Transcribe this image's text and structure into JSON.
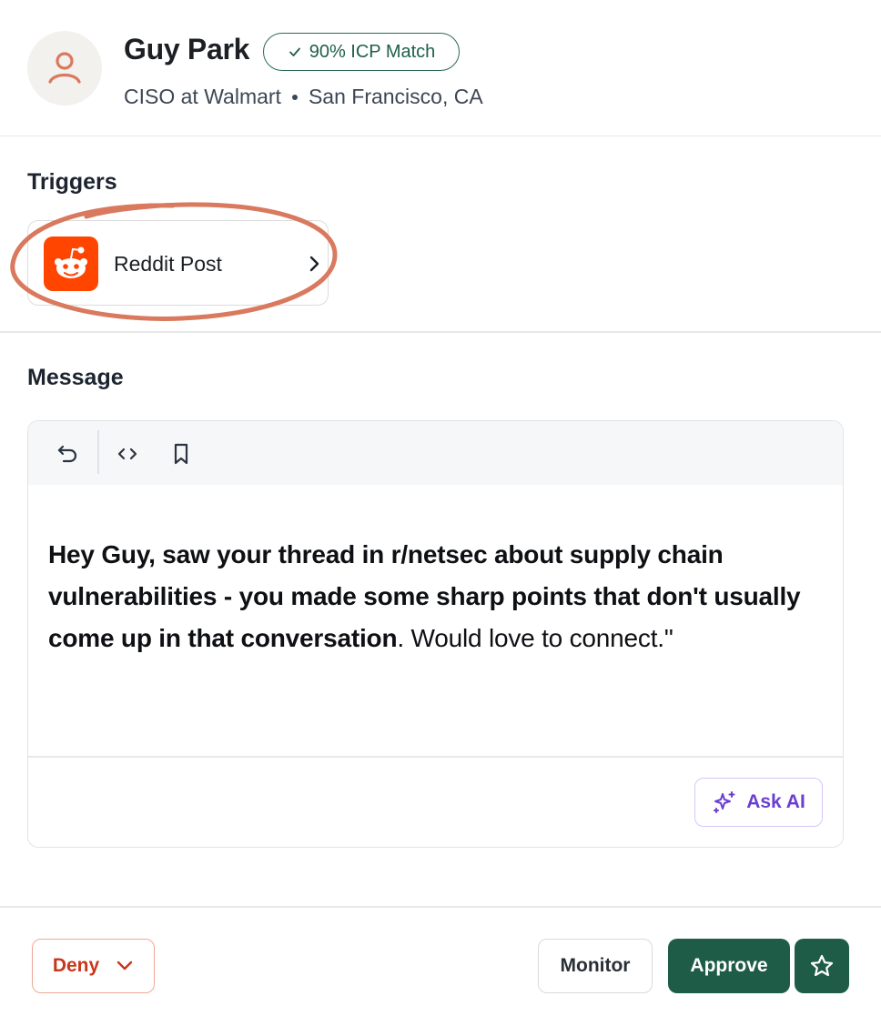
{
  "profile": {
    "name": "Guy Park",
    "icp_badge": "90% ICP Match",
    "title": "CISO at Walmart",
    "location": "San Francisco, CA",
    "avatar_icon": "user-icon"
  },
  "triggers": {
    "title": "Triggers",
    "items": [
      {
        "label": "Reddit Post",
        "icon": "reddit-icon"
      }
    ]
  },
  "message": {
    "title": "Message",
    "toolbar": [
      "undo-icon",
      "code-icon",
      "bookmark-icon"
    ],
    "bold_text": "Hey Guy, saw your thread in r/netsec about supply chain vulnerabilities - you made some sharp points that don't usually come up in that conversation",
    "plain_text": ". Would love to connect.\"",
    "ask_ai_label": "Ask AI"
  },
  "actions": {
    "deny_label": "Deny",
    "monitor_label": "Monitor",
    "approve_label": "Approve"
  },
  "colors": {
    "brand_green": "#1f5c48",
    "reddit": "#ff4500",
    "deny_red": "#c8361c",
    "ai_purple": "#6a3fd1",
    "highlight": "#d9795e"
  }
}
